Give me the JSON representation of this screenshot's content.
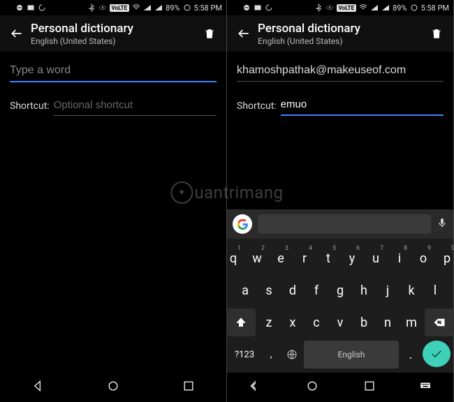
{
  "status": {
    "battery": "89%",
    "time": "5:58 PM"
  },
  "appbar": {
    "title": "Personal dictionary",
    "subtitle": "English (United States)"
  },
  "left": {
    "word_value": "",
    "word_placeholder": "Type a word",
    "shortcut_label": "Shortcut:",
    "shortcut_placeholder": "Optional shortcut",
    "shortcut_value": ""
  },
  "right": {
    "word_value": "khamoshpathak@makeuseof.com",
    "shortcut_label": "Shortcut:",
    "shortcut_value": "emuo"
  },
  "watermark": "uantrimang",
  "keyboard": {
    "row1": [
      {
        "k": "q",
        "s": "1"
      },
      {
        "k": "w",
        "s": "2"
      },
      {
        "k": "e",
        "s": "3"
      },
      {
        "k": "r",
        "s": "4"
      },
      {
        "k": "t",
        "s": "5"
      },
      {
        "k": "y",
        "s": "6"
      },
      {
        "k": "u",
        "s": "7"
      },
      {
        "k": "i",
        "s": "8"
      },
      {
        "k": "o",
        "s": "9"
      },
      {
        "k": "p",
        "s": "0"
      }
    ],
    "row2": [
      "a",
      "s",
      "d",
      "f",
      "g",
      "h",
      "j",
      "k",
      "l"
    ],
    "row3": [
      "z",
      "x",
      "c",
      "v",
      "b",
      "n",
      "m"
    ],
    "symbols_key": "?123",
    "space_label": "English",
    "dot": "."
  }
}
